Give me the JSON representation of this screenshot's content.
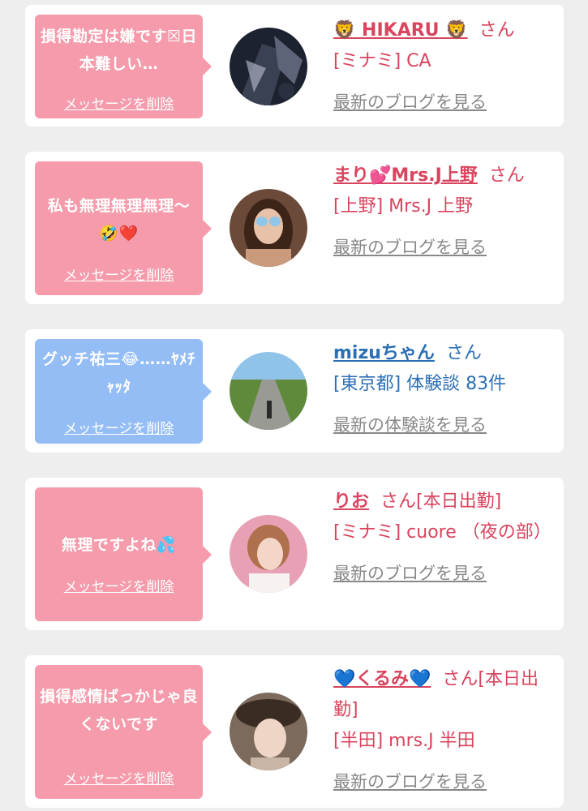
{
  "cards": [
    {
      "message": "損得勘定は嫌です☒日本難しい…",
      "delete_label": "メッセージを削除",
      "name": "🦁 HIKARU 🦁",
      "suffix": "さん",
      "location": "[ミナミ] CA",
      "link": "最新のブログを見る",
      "avatar_icon": "dark-abstract-avatar"
    },
    {
      "message": "私も無理無理無理〜🤣❤️",
      "delete_label": "メッセージを削除",
      "name": "まり💕Mrs.J上野",
      "suffix": "さん",
      "location": "[上野] Mrs.J 上野",
      "link": "最新のブログを見る",
      "avatar_icon": "woman-portrait-avatar"
    },
    {
      "message": "グッチ祐三😂……ﾔﾒﾁｬｯﾀ",
      "delete_label": "メッセージを削除",
      "name": "mizuちゃん",
      "suffix": "さん",
      "location": "[東京都] 体験談 83件",
      "link": "最新の体験談を見る",
      "avatar_icon": "road-landscape-avatar"
    },
    {
      "message": "無理ですよね💦",
      "delete_label": "メッセージを削除",
      "name": "りお",
      "suffix": "さん[本日出勤]",
      "location": "[ミナミ] cuore （夜の部）",
      "link": "最新のブログを見る",
      "avatar_icon": "woman-portrait-avatar"
    },
    {
      "message": "損得感情ばっかじゃ良くないです",
      "delete_label": "メッセージを削除",
      "name": "💙くるみ💙",
      "suffix": "さん[本日出勤]",
      "location": "[半田] mrs.J 半田",
      "link": "最新のブログを見る",
      "avatar_icon": "woman-hat-avatar"
    }
  ],
  "colors": {
    "pink_bubble": "#f59bab",
    "blue_bubble": "#94bdf6",
    "name_pink": "#d9445e",
    "name_blue": "#2c6fb5",
    "link_gray": "#888888",
    "background": "#eeeeee"
  }
}
